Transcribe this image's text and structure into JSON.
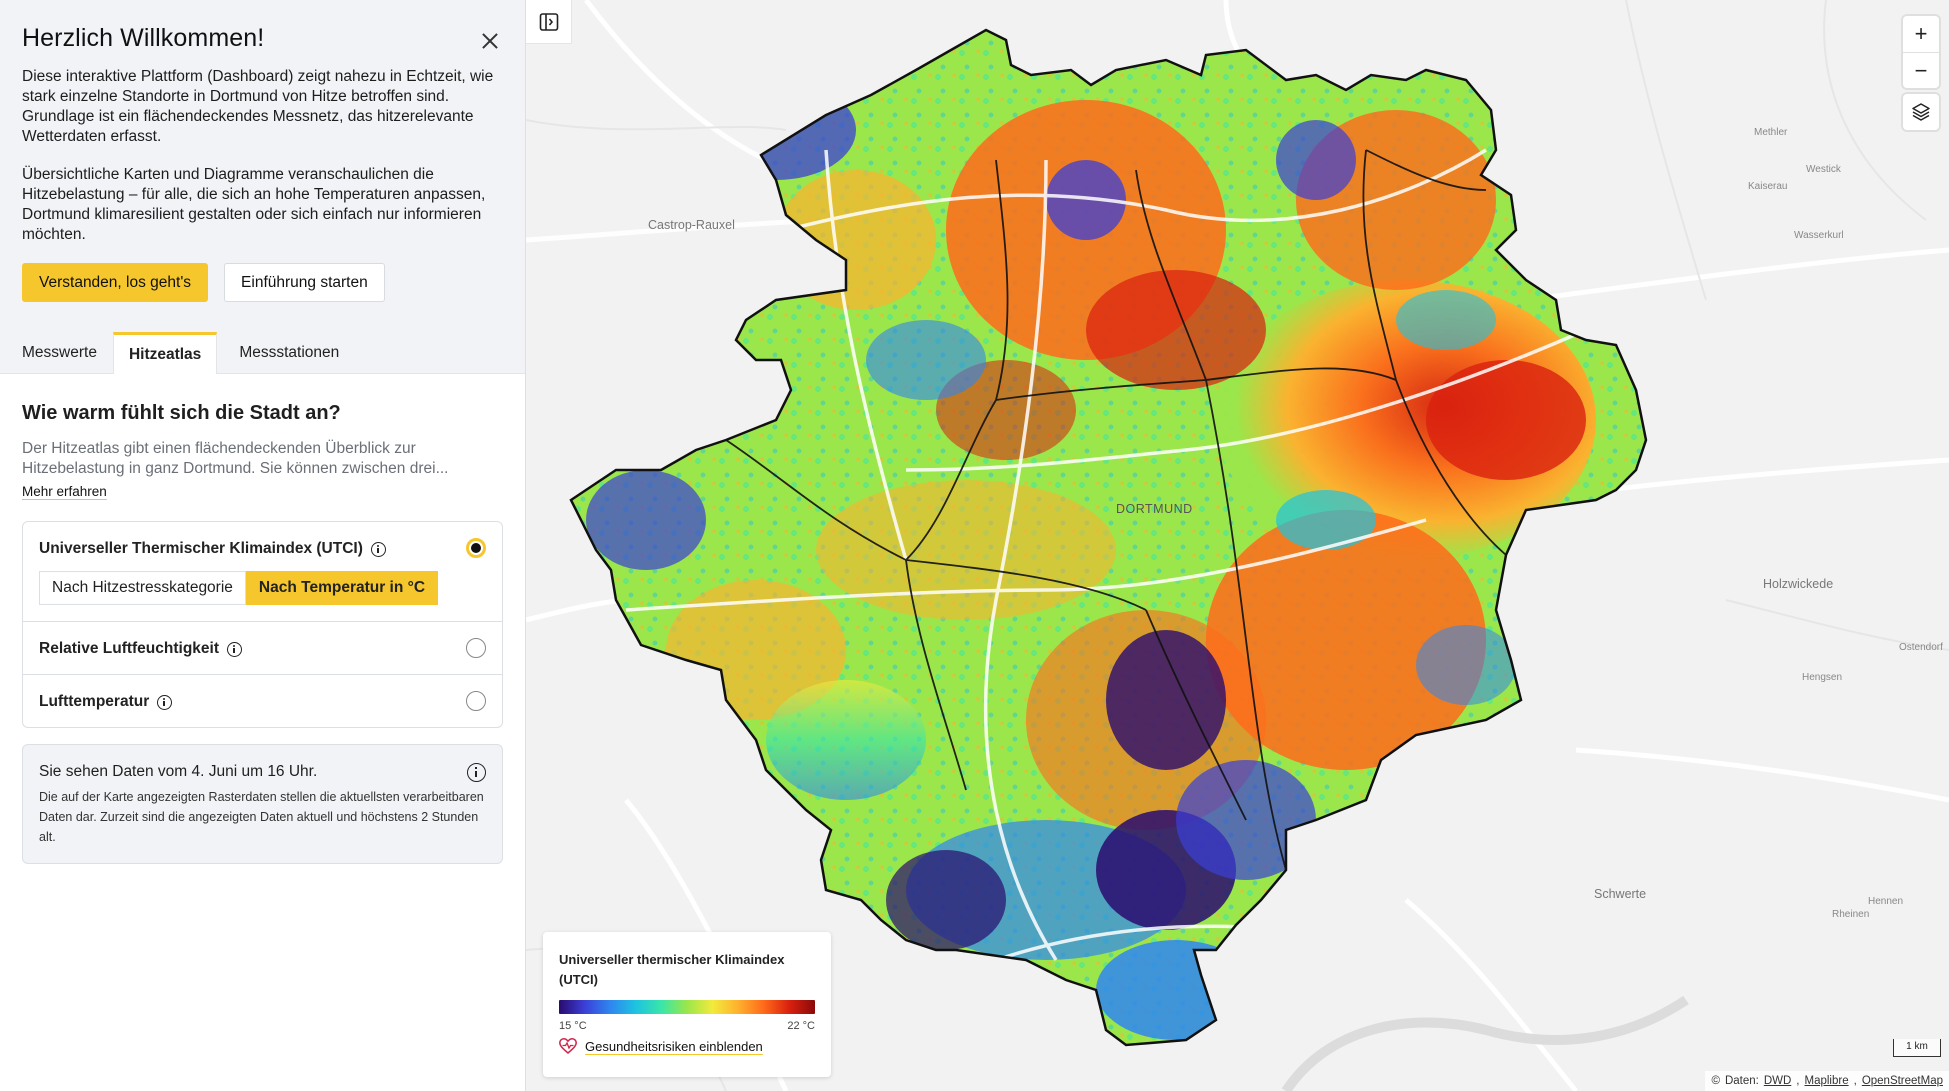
{
  "welcome": {
    "title": "Herzlich Willkommen!",
    "paragraph1": "Diese interaktive Plattform (Dashboard) zeigt nahezu in Echtzeit, wie stark einzelne Standorte in Dortmund von Hitze betroffen sind. Grundlage ist ein flächendeckendes Messnetz, das hitzerelevante Wetterdaten erfasst.",
    "paragraph2": "Übersichtliche Karten und Diagramme veranschaulichen die Hitzebelastung – für alle, die sich an hohe Temperaturen anpassen, Dortmund klimaresilient gestalten oder sich einfach nur informieren möchten.",
    "primary_button": "Verstanden, los geht's",
    "secondary_button": "Einführung starten"
  },
  "tabs": [
    {
      "label": "Messwerte",
      "active": false
    },
    {
      "label": "Hitzeatlas",
      "active": true
    },
    {
      "label": "Messstationen",
      "active": false
    }
  ],
  "content": {
    "heading": "Wie warm fühlt sich die Stadt an?",
    "description": "Der Hitzeatlas gibt einen flächendeckenden Überblick zur Hitzebelastung in ganz Dortmund. Sie können zwischen drei...",
    "more_link": "Mehr erfahren"
  },
  "options": {
    "utci": {
      "label": "Universeller Thermischer Klimaindex (UTCI)",
      "selected": true
    },
    "segment": {
      "left": "Nach Hitzestresskategorie",
      "right": "Nach Temperatur in °C",
      "active": "right"
    },
    "humidity": {
      "label": "Relative Luftfeuchtigkeit",
      "selected": false
    },
    "temperature": {
      "label": "Lufttemperatur",
      "selected": false
    }
  },
  "notice": {
    "title": "Sie sehen Daten vom 4. Juni um 16 Uhr.",
    "body": "Die auf der Karte angezeigten Rasterdaten stellen die aktuellsten verarbeitbaren Daten dar. Zurzeit sind die angezeigten Daten aktuell und höchstens 2 Stunden alt."
  },
  "map": {
    "center_label": "DORTMUND",
    "places": {
      "castrop": "Castrop-Rauxel",
      "holzwickede": "Holzwickede",
      "schwerte": "Schwerte",
      "methler": "Methler",
      "westick": "Westick",
      "kaiserau": "Kaiserau",
      "wasserkurl": "Wasserkurl",
      "hengsen": "Hengsen",
      "ostendorf": "Ostendorf",
      "hennen": "Hennen",
      "rheinen": "Rheinen"
    },
    "zoom_in": "+",
    "zoom_out": "−",
    "scale": "1 km",
    "attribution": {
      "prefix": "Daten:",
      "dwd": "DWD",
      "maplibre": "Maplibre",
      "osm": "OpenStreetMap"
    }
  },
  "legend": {
    "title": "Universeller thermischer Klimaindex (UTCI)",
    "min": "15 °C",
    "max": "22 °C",
    "link": "Gesundheitsrisiken einblenden"
  },
  "colors": {
    "accent": "#f6c72d",
    "scale": [
      "#2a0b6e",
      "#3b3fd7",
      "#2f86f0",
      "#1ec3e0",
      "#39e6a8",
      "#9be64a",
      "#f2ea3c",
      "#ffb02e",
      "#ff6a1a",
      "#d9200f",
      "#8a0a0a"
    ]
  }
}
